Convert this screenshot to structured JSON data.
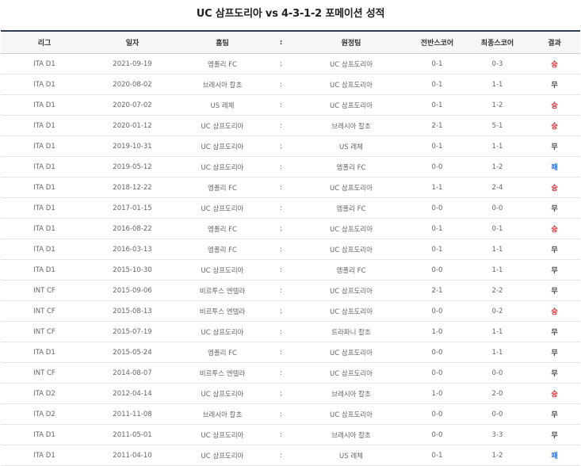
{
  "page": {
    "title": "UC 삼프도리아 vs 4-3-1-2 포메이션 성적"
  },
  "table": {
    "headers": {
      "league": "리그",
      "date": "일자",
      "home": "홈팀",
      "sep": ":",
      "away": "원정팀",
      "half": "전반스코어",
      "final": "최종스코어",
      "result": "결과"
    },
    "result_colors": {
      "승": "#d8262b",
      "무": "#444444",
      "패": "#2e6fd6"
    },
    "rows": [
      {
        "league": "ITA D1",
        "date": "2021-09-19",
        "home": "엠폴리 FC",
        "sep": ":",
        "away": "UC 삼프도리아",
        "half": "0-1",
        "final": "0-3",
        "result": "승"
      },
      {
        "league": "ITA D1",
        "date": "2020-08-02",
        "home": "브레시아 칼초",
        "sep": ":",
        "away": "UC 삼프도리아",
        "half": "0-1",
        "final": "1-1",
        "result": "무"
      },
      {
        "league": "ITA D1",
        "date": "2020-07-02",
        "home": "US 레체",
        "sep": ":",
        "away": "UC 삼프도리아",
        "half": "0-1",
        "final": "1-2",
        "result": "승"
      },
      {
        "league": "ITA D1",
        "date": "2020-01-12",
        "home": "UC 삼프도리아",
        "sep": ":",
        "away": "브레시아 칼초",
        "half": "2-1",
        "final": "5-1",
        "result": "승"
      },
      {
        "league": "ITA D1",
        "date": "2019-10-31",
        "home": "UC 삼프도리아",
        "sep": ":",
        "away": "US 레체",
        "half": "0-1",
        "final": "1-1",
        "result": "무"
      },
      {
        "league": "ITA D1",
        "date": "2019-05-12",
        "home": "UC 삼프도리아",
        "sep": ":",
        "away": "엠폴리 FC",
        "half": "0-0",
        "final": "1-2",
        "result": "패"
      },
      {
        "league": "ITA D1",
        "date": "2018-12-22",
        "home": "엠폴리 FC",
        "sep": ":",
        "away": "UC 삼프도리아",
        "half": "1-1",
        "final": "2-4",
        "result": "승"
      },
      {
        "league": "ITA D1",
        "date": "2017-01-15",
        "home": "UC 삼프도리아",
        "sep": ":",
        "away": "엠폴리 FC",
        "half": "0-0",
        "final": "0-0",
        "result": "무"
      },
      {
        "league": "ITA D1",
        "date": "2016-08-22",
        "home": "엠폴리 FC",
        "sep": ":",
        "away": "UC 삼프도리아",
        "half": "0-1",
        "final": "0-1",
        "result": "승"
      },
      {
        "league": "ITA D1",
        "date": "2016-03-13",
        "home": "엠폴리 FC",
        "sep": ":",
        "away": "UC 삼프도리아",
        "half": "0-1",
        "final": "1-1",
        "result": "무"
      },
      {
        "league": "ITA D1",
        "date": "2015-10-30",
        "home": "UC 삼프도리아",
        "sep": ":",
        "away": "엠폴리 FC",
        "half": "0-0",
        "final": "1-1",
        "result": "무"
      },
      {
        "league": "INT CF",
        "date": "2015-09-06",
        "home": "비르투스 엔텔라",
        "sep": ":",
        "away": "UC 삼프도리아",
        "half": "2-1",
        "final": "2-2",
        "result": "무"
      },
      {
        "league": "INT CF",
        "date": "2015-08-13",
        "home": "비르투스 엔텔라",
        "sep": ":",
        "away": "UC 삼프도리아",
        "half": "0-0",
        "final": "0-2",
        "result": "승"
      },
      {
        "league": "INT CF",
        "date": "2015-07-19",
        "home": "UC 삼프도리아",
        "sep": ":",
        "away": "트라파니 칼초",
        "half": "1-0",
        "final": "1-1",
        "result": "무"
      },
      {
        "league": "ITA D1",
        "date": "2015-05-24",
        "home": "엠폴리 FC",
        "sep": ":",
        "away": "UC 삼프도리아",
        "half": "0-0",
        "final": "1-1",
        "result": "무"
      },
      {
        "league": "INT CF",
        "date": "2014-08-07",
        "home": "비르투스 엔텔라",
        "sep": ":",
        "away": "UC 삼프도리아",
        "half": "0-0",
        "final": "0-0",
        "result": "무"
      },
      {
        "league": "ITA D2",
        "date": "2012-04-14",
        "home": "UC 삼프도리아",
        "sep": ":",
        "away": "브레시아 칼초",
        "half": "1-0",
        "final": "2-0",
        "result": "승"
      },
      {
        "league": "ITA D2",
        "date": "2011-11-08",
        "home": "브레시아 칼초",
        "sep": ":",
        "away": "UC 삼프도리아",
        "half": "0-0",
        "final": "0-0",
        "result": "무"
      },
      {
        "league": "ITA D1",
        "date": "2011-05-01",
        "home": "UC 삼프도리아",
        "sep": ":",
        "away": "브레시아 칼초",
        "half": "0-0",
        "final": "3-3",
        "result": "무"
      },
      {
        "league": "ITA D1",
        "date": "2011-04-10",
        "home": "UC 삼프도리아",
        "sep": ":",
        "away": "US 레체",
        "half": "0-1",
        "final": "1-2",
        "result": "패"
      }
    ]
  }
}
